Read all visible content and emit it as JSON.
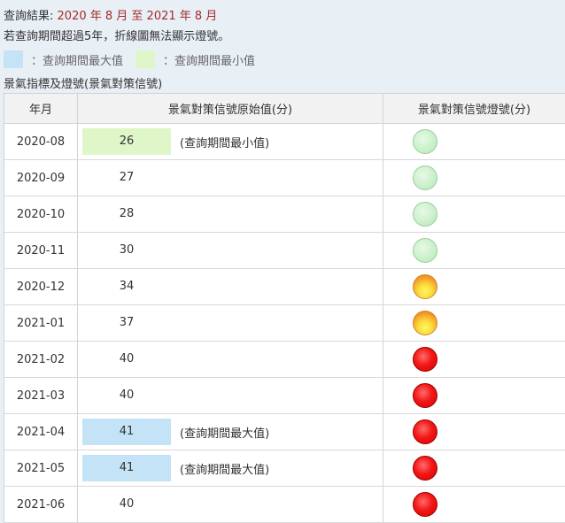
{
  "query": {
    "result_label": "查詢結果:",
    "range_text": "2020 年 8 月 至 2021 年 8 月",
    "note": "若查詢期間超過5年，折線圖無法顯示燈號。"
  },
  "legend": {
    "max_label": "：查詢期間最大值",
    "min_label": "：查詢期間最小值",
    "max_color": "#c5e3f6",
    "min_color": "#dff7c8"
  },
  "section_title": "景氣指標及燈號(景氣對策信號)",
  "table": {
    "headers": [
      "年月",
      "景氣對策信號原始值(分)",
      "景氣對策信號燈號(分)"
    ],
    "rows": [
      {
        "month": "2020-08",
        "value": "26",
        "note": "(查詢期間最小值)",
        "highlight": "min",
        "light": "green"
      },
      {
        "month": "2020-09",
        "value": "27",
        "note": "",
        "highlight": "",
        "light": "green"
      },
      {
        "month": "2020-10",
        "value": "28",
        "note": "",
        "highlight": "",
        "light": "green"
      },
      {
        "month": "2020-11",
        "value": "30",
        "note": "",
        "highlight": "",
        "light": "green"
      },
      {
        "month": "2020-12",
        "value": "34",
        "note": "",
        "highlight": "",
        "light": "yellow-red"
      },
      {
        "month": "2021-01",
        "value": "37",
        "note": "",
        "highlight": "",
        "light": "yellow-red"
      },
      {
        "month": "2021-02",
        "value": "40",
        "note": "",
        "highlight": "",
        "light": "red"
      },
      {
        "month": "2021-03",
        "value": "40",
        "note": "",
        "highlight": "",
        "light": "red"
      },
      {
        "month": "2021-04",
        "value": "41",
        "note": "(查詢期間最大值)",
        "highlight": "max",
        "light": "red"
      },
      {
        "month": "2021-05",
        "value": "41",
        "note": "(查詢期間最大值)",
        "highlight": "max",
        "light": "red"
      },
      {
        "month": "2021-06",
        "value": "40",
        "note": "",
        "highlight": "",
        "light": "red"
      }
    ]
  }
}
